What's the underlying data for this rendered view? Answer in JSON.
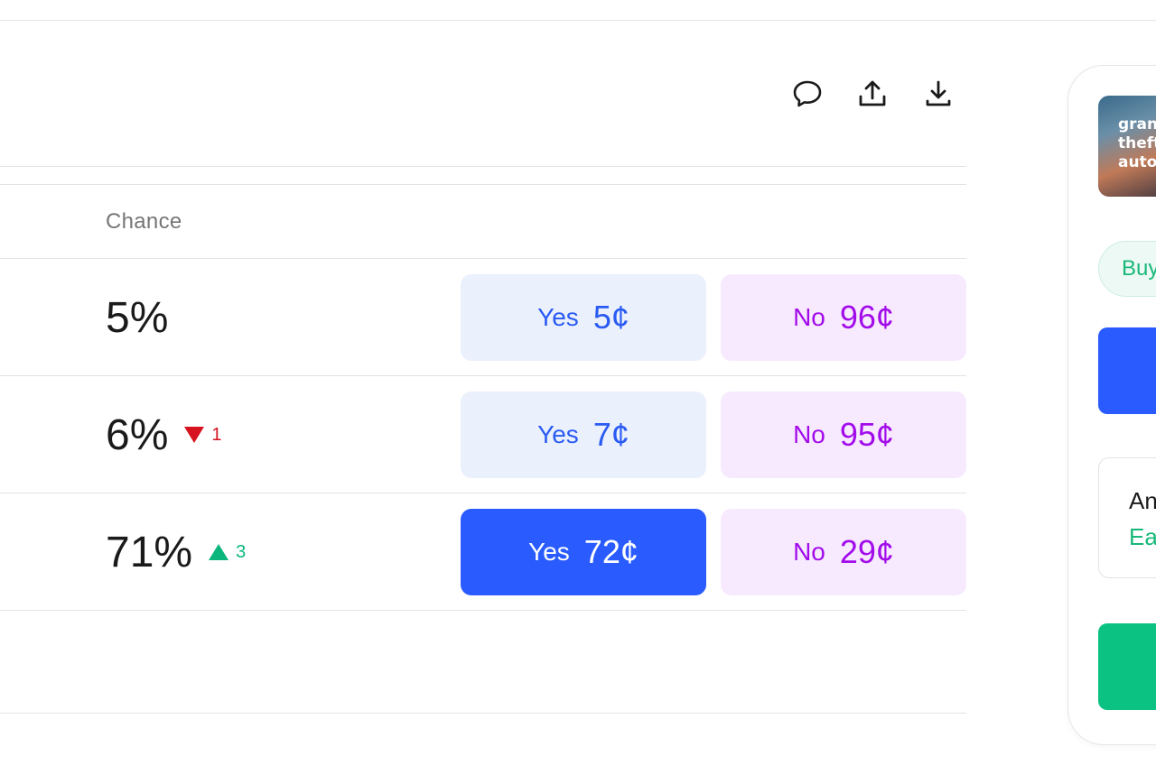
{
  "toolbar": {
    "comment_icon": "comment-icon",
    "share_icon": "share-icon",
    "download_icon": "download-icon"
  },
  "table": {
    "header_chance": "Chance",
    "rows": [
      {
        "chance": "5%",
        "delta": "",
        "delta_dir": "",
        "yes_label": "Yes",
        "yes_price": "5¢",
        "no_label": "No",
        "no_price": "96¢",
        "yes_selected": false
      },
      {
        "chance": "6%",
        "delta": "1",
        "delta_dir": "down",
        "yes_label": "Yes",
        "yes_price": "7¢",
        "no_label": "No",
        "no_price": "95¢",
        "yes_selected": false
      },
      {
        "chance": "71%",
        "delta": "3",
        "delta_dir": "up",
        "yes_label": "Yes",
        "yes_price": "72¢",
        "no_label": "No",
        "no_price": "29¢",
        "yes_selected": true
      }
    ]
  },
  "side_panel": {
    "thumbnail_text": "grand theft auto",
    "buy_label": "Buy",
    "info_title": "An",
    "info_subtitle": "Ea"
  },
  "colors": {
    "yes_active": "#2a5bff",
    "yes_inactive_bg": "#ebf0fd",
    "no_bg": "#f7eafe",
    "no_text": "#a20bea",
    "delta_up": "#0ab67c",
    "delta_down": "#d6131f",
    "green_cta": "#0bc283"
  }
}
